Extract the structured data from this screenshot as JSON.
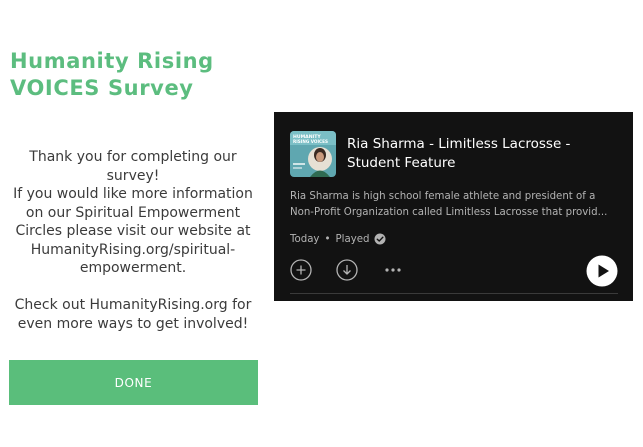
{
  "survey": {
    "title_line1": "Humanity Rising",
    "title_line2": "VOICES Survey",
    "thanks": "Thank you for completing our survey!",
    "info": "If you would like more information on our Spiritual Empowerment Circles please visit our website at HumanityRising.org/spiritual-empowerment.",
    "more": "Check out HumanityRising.org for even more ways to get involved!",
    "done_label": "DONE"
  },
  "podcast_embed": {
    "cover_text_line1": "HUMANITY",
    "cover_text_line2": "RISING VOICES",
    "episode_title": "Ria Sharma - Limitless Lacrosse - Student Feature",
    "description": "Ria Sharma is high school female athlete and president of a Non-Profit Organization called Limitless Lacrosse that provid...",
    "date": "Today",
    "separator": "•",
    "status": "Played",
    "icons": [
      "add-icon",
      "download-icon",
      "more-icon",
      "play-icon",
      "check-icon"
    ]
  },
  "colors": {
    "brand_green": "#5cbd7f",
    "button_green": "#5abe7b",
    "embed_bg": "#121212",
    "cover_teal": "#5fa7b0"
  }
}
